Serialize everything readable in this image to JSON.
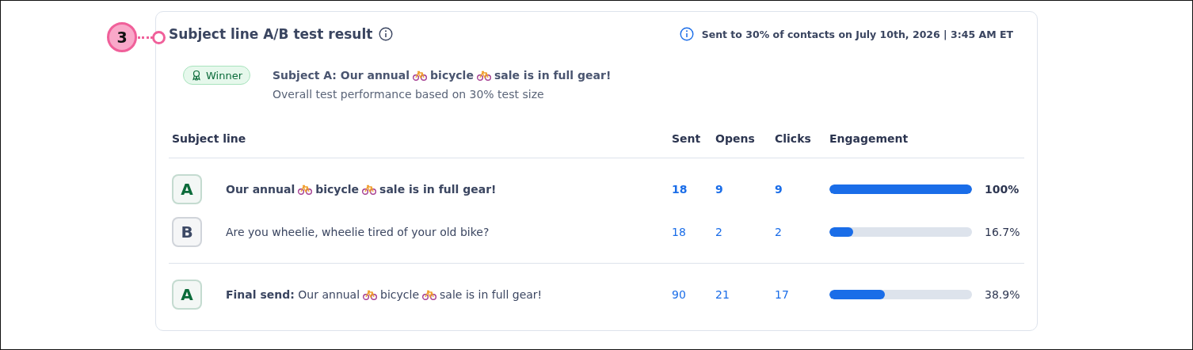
{
  "step_marker": "3",
  "header": {
    "title": "Subject line A/B test result",
    "sent_info": "Sent to 30% of contacts on July 10th, 2026 | 3:45 AM ET"
  },
  "winner": {
    "badge": "Winner",
    "subject": [
      {
        "kind": "text",
        "text": "Subject A: Our annual"
      },
      {
        "kind": "bike"
      },
      {
        "kind": "text",
        "text": "bicycle"
      },
      {
        "kind": "bike"
      },
      {
        "kind": "text",
        "text": "sale is in full gear!"
      }
    ],
    "note": "Overall test performance based on 30% test size"
  },
  "table": {
    "columns": [
      "Subject line",
      "Sent",
      "Opens",
      "Clicks",
      "Engagement"
    ],
    "groups": [
      [
        {
          "letter": "A",
          "color": "#0b6b3a",
          "bold": true,
          "subject": [
            {
              "kind": "text",
              "text": "Our annual"
            },
            {
              "kind": "bike"
            },
            {
              "kind": "text",
              "text": "bicycle"
            },
            {
              "kind": "bike"
            },
            {
              "kind": "text",
              "text": "sale is in full gear!"
            }
          ],
          "sent": "18",
          "opens": "9",
          "clicks": "9",
          "level": 1,
          "reading": "100%"
        },
        {
          "letter": "B",
          "color": "#3d4a66",
          "bold": false,
          "subject": [
            {
              "kind": "text",
              "text": "Are you wheelie, wheelie tired of your old bike?"
            }
          ],
          "sent": "18",
          "opens": "2",
          "clicks": "2",
          "level": 0.167,
          "reading": "16.7%"
        }
      ],
      [
        {
          "letter": "A",
          "color": "#0b6b3a",
          "bold": false,
          "subject": [
            {
              "kind": "text",
              "text": "**Final send:** Our annual"
            },
            {
              "kind": "bike"
            },
            {
              "kind": "text",
              "text": "bicycle"
            },
            {
              "kind": "bike"
            },
            {
              "kind": "text",
              "text": "sale is in full gear!"
            }
          ],
          "sent": "90",
          "opens": "21",
          "clicks": "17",
          "level": 0.389,
          "reading": "38.9%"
        }
      ]
    ]
  }
}
